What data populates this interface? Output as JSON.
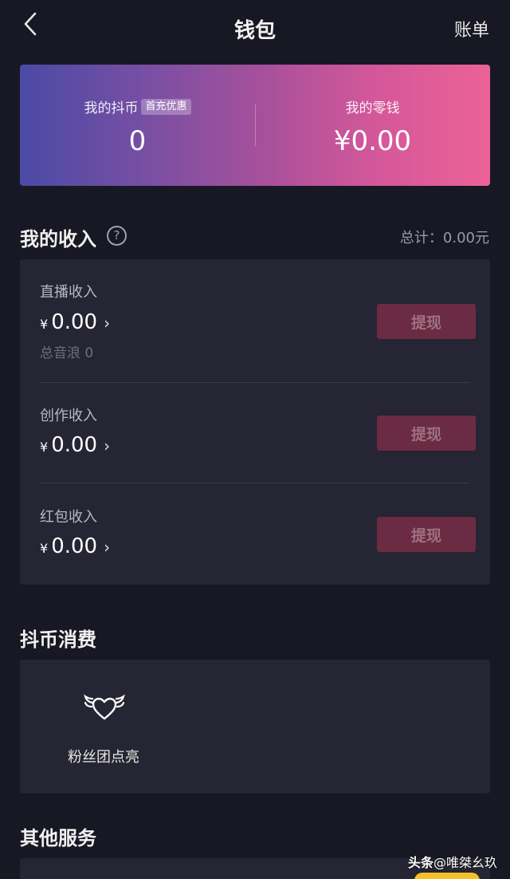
{
  "header": {
    "title": "钱包",
    "bill_label": "账单"
  },
  "balance": {
    "coins_label": "我的抖币",
    "promo_badge": "首充优惠",
    "coins_value": "0",
    "change_label": "我的零钱",
    "change_value": "¥0.00"
  },
  "income": {
    "title": "我的收入",
    "help_symbol": "?",
    "total_text": "总计：0.00元",
    "items": [
      {
        "label": "直播收入",
        "currency": "¥",
        "amount": "0.00",
        "chevron": "›",
        "sub": "总音浪 0",
        "button": "提现"
      },
      {
        "label": "创作收入",
        "currency": "¥",
        "amount": "0.00",
        "chevron": "›",
        "button": "提现"
      },
      {
        "label": "红包收入",
        "currency": "¥",
        "amount": "0.00",
        "chevron": "›",
        "button": "提现"
      }
    ]
  },
  "consumption": {
    "title": "抖币消费",
    "items": [
      {
        "label": "粉丝团点亮",
        "icon": "heart-wings-icon"
      }
    ]
  },
  "services": {
    "title": "其他服务"
  },
  "watermark": {
    "brand": "头条",
    "handle": "@唯桀幺玖"
  },
  "colors": {
    "background": "#181824",
    "card": "#252533",
    "withdraw_button": "#6b2b43",
    "gradient_start": "#4b4aa6",
    "gradient_end": "#ec6296"
  }
}
